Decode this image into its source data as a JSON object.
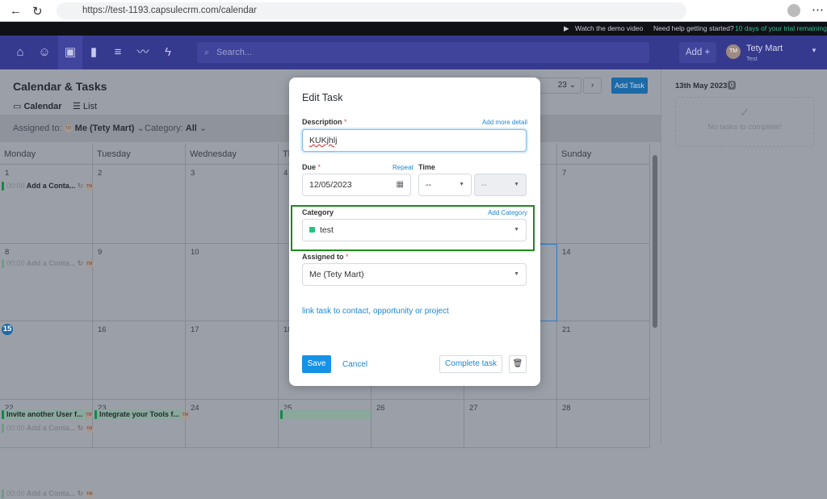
{
  "browser": {
    "url": "https://test-1193.capsulecrm.com/calendar"
  },
  "topstrip": {
    "demo": "Watch the demo video",
    "help": "Need help getting started?",
    "trial": "10 days of your trial remaining"
  },
  "nav": {
    "search_placeholder": "Search...",
    "add": "Add +",
    "user_initials": "TM",
    "user_name": "Tety Mart",
    "user_sub": "Test",
    "brand_color": "#363a8e"
  },
  "page": {
    "title": "Calendar & Tasks",
    "tabs": [
      "Calendar",
      "List"
    ],
    "month_select": "23",
    "add_task": "Add Task"
  },
  "filters": {
    "assigned_label": "Assigned to:",
    "assigned_value": "Me (Tety Mart)",
    "category_label": "Category:",
    "category_value": "All"
  },
  "calendar": {
    "days": [
      "Monday",
      "Tuesday",
      "Wednesday",
      "Thursday",
      "Friday",
      "Saturday",
      "Sunday"
    ],
    "weeks": [
      [
        "1",
        "2",
        "3",
        "4",
        "",
        "",
        "7"
      ],
      [
        "8",
        "9",
        "10",
        "",
        "",
        "",
        "14"
      ],
      [
        "15",
        "16",
        "17",
        "18",
        "",
        "",
        "21"
      ],
      [
        "22",
        "23",
        "24",
        "25",
        "26",
        "27",
        "28"
      ]
    ],
    "today": "15",
    "tasks": {
      "time": "00:00",
      "add_contact": "Add a Conta...",
      "invite": "Invite another User f...",
      "integrate": "Integrate your Tools f...",
      "initials": "TM"
    }
  },
  "sidebar": {
    "date": "13th May 2023",
    "count": "0",
    "empty": "No tasks to complete!"
  },
  "modal": {
    "title": "Edit Task",
    "description_label": "Description",
    "add_more_detail": "Add more detail",
    "description_value": "KUKjhlj",
    "due_label": "Due",
    "repeat": "Repeat",
    "due_value": "12/05/2023",
    "time_label": "Time",
    "time_hour": "--",
    "time_min": "--",
    "category_label": "Category",
    "add_category": "Add Category",
    "category_value": "test",
    "category_color": "#1fc77e",
    "assigned_label": "Assigned to",
    "assigned_value": "Me (Tety Mart)",
    "link_task": "link task to contact, opportunity or project",
    "save": "Save",
    "cancel": "Cancel",
    "complete": "Complete task"
  }
}
